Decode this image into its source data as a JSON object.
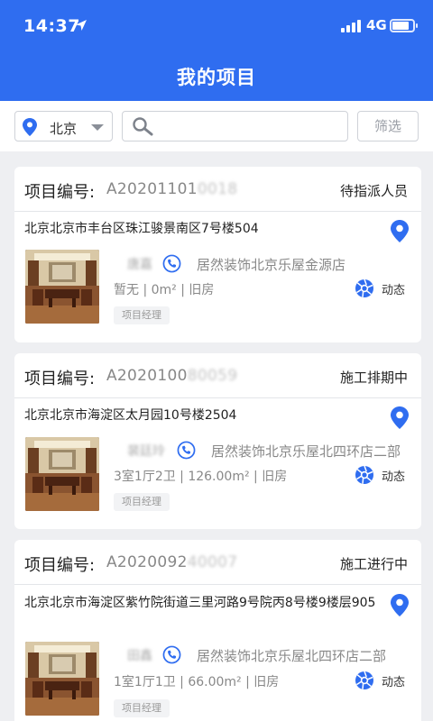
{
  "status_bar": {
    "time": "14:37",
    "network": "4G",
    "battery_level": 0.75
  },
  "header": {
    "title": "我的项目"
  },
  "filters": {
    "city": "北京",
    "search_placeholder": "",
    "filter_button": "筛选"
  },
  "projects": [
    {
      "number_label": "项目编号:",
      "number_visible": "A20201101",
      "number_blurred": "0018",
      "status": "待指派人员",
      "address": "北京北京市丰台区珠江骏景南区7号楼504",
      "person": "唐嘉",
      "store": "居然装饰北京乐屋金源店",
      "specs": "暂无 | 0m² | 旧房",
      "role": "项目经理",
      "dynamic_label": "动态"
    },
    {
      "number_label": "项目编号:",
      "number_visible": "A2020100",
      "number_blurred": "80059",
      "status": "施工排期中",
      "address": "北京北京市海淀区太月园10号楼2504",
      "person": "裴廷玲",
      "store": "居然装饰北京乐屋北四环店二部",
      "specs": "3室1厅2卫 | 126.00m² | 旧房",
      "role": "项目经理",
      "dynamic_label": "动态"
    },
    {
      "number_label": "项目编号:",
      "number_visible": "A2020092",
      "number_blurred": "40007",
      "status": "施工进行中",
      "address": "北京北京市海淀区紫竹院街道三里河路9号院丙8号楼9楼层905",
      "person": "田鑫",
      "store": "居然装饰北京乐屋北四环店二部",
      "specs": "1室1厅1卫 | 66.00m² | 旧房",
      "role": "项目经理",
      "dynamic_label": "动态"
    }
  ],
  "colors": {
    "accent": "#2f6df0",
    "background": "#eeeff2"
  }
}
